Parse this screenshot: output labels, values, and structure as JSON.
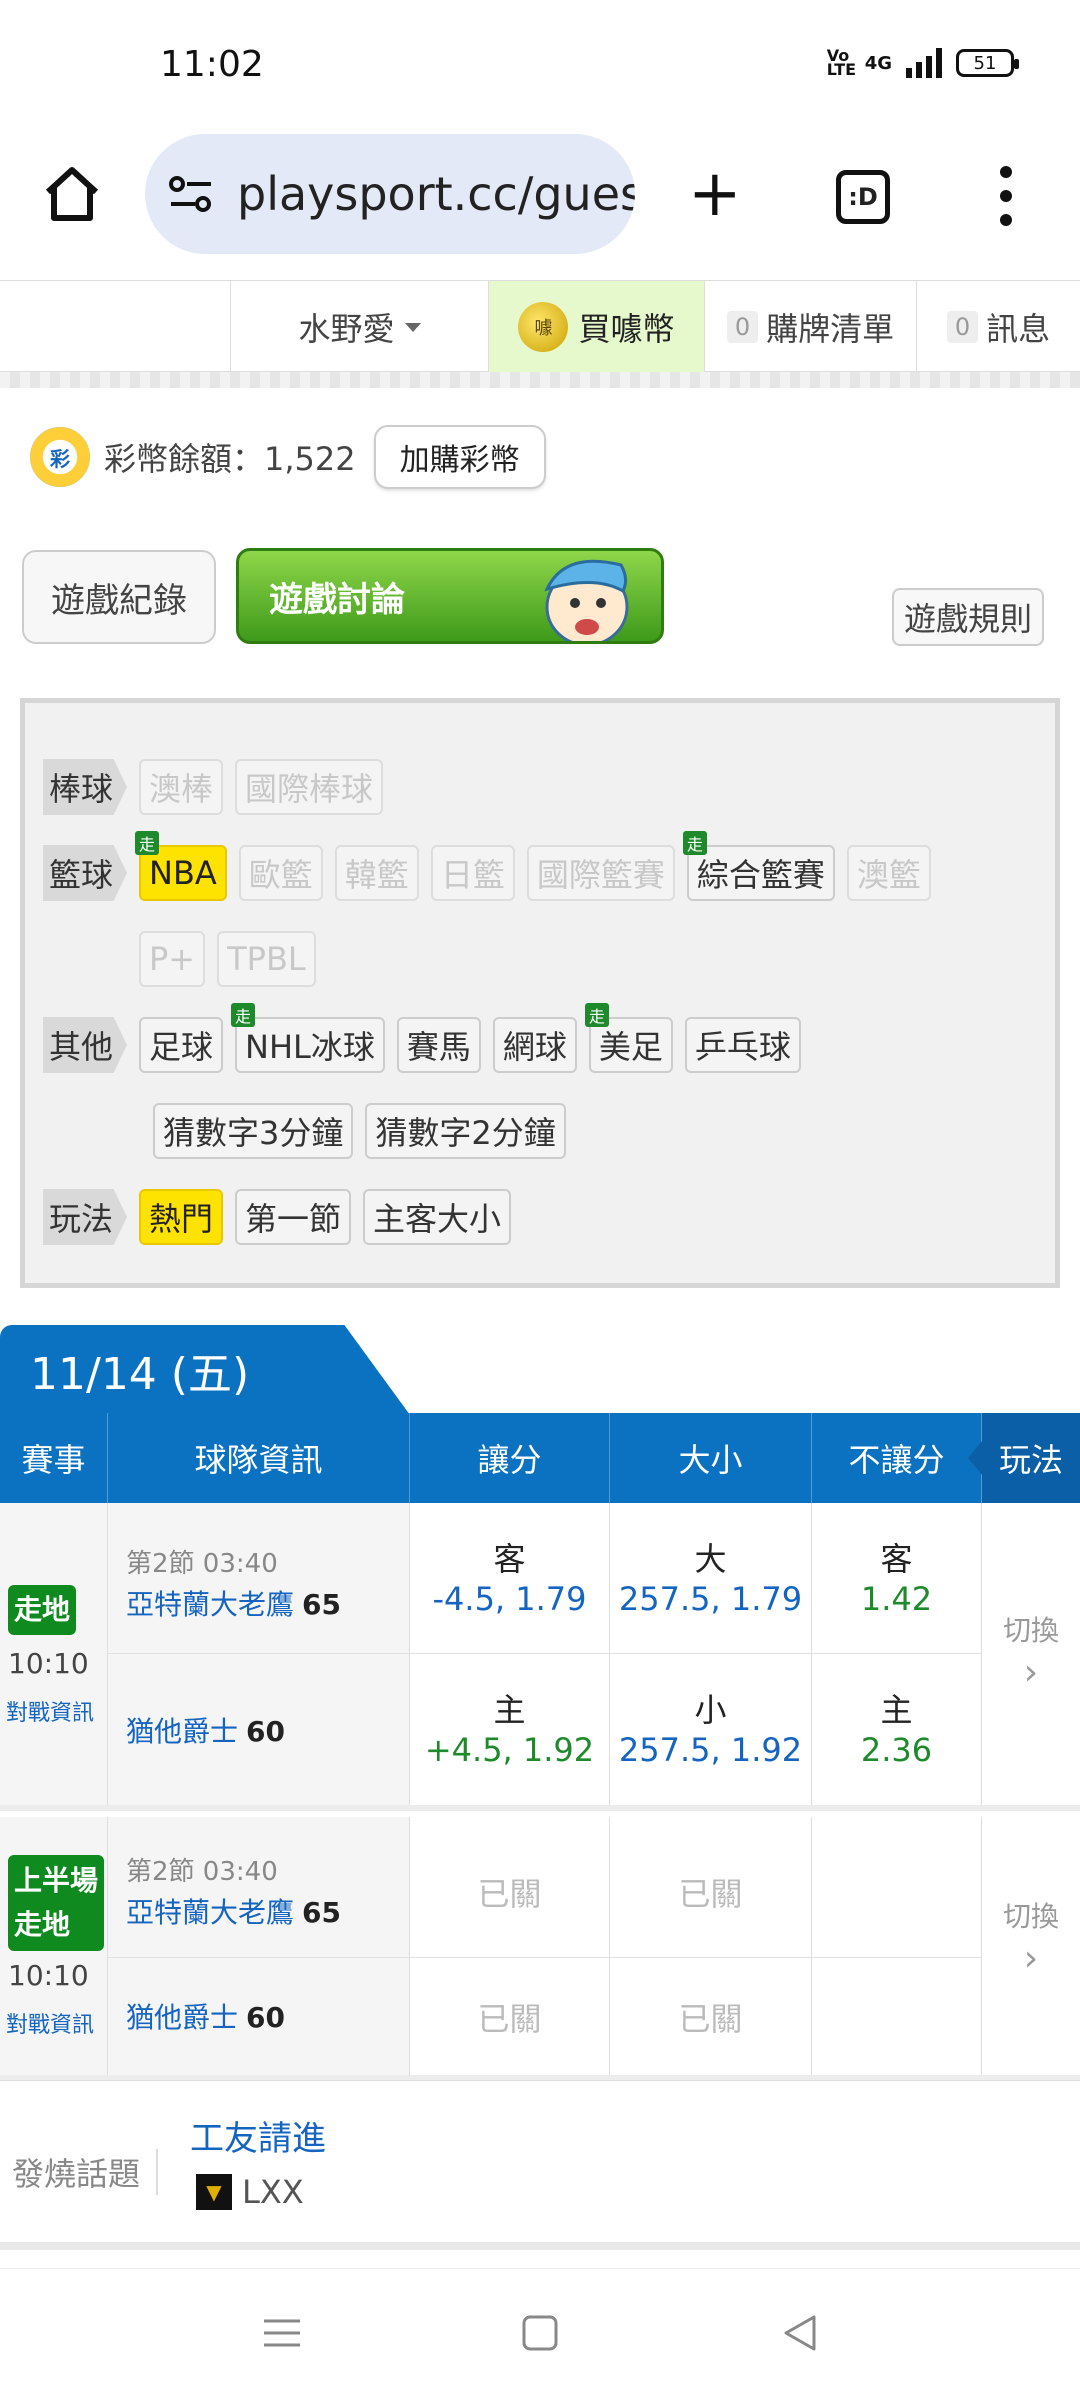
{
  "status_bar": {
    "time": "11:02",
    "volte": "Vo LTE",
    "network": "4G",
    "battery": "51"
  },
  "browser": {
    "url": "playsport.cc/gues",
    "tabs_label": ":D"
  },
  "site_nav": {
    "user": "水野愛",
    "buy_coins": "買噱幣",
    "coin_icon_text": "噱",
    "cart_count": "0",
    "cart_label": "購牌清單",
    "msg_count": "0",
    "msg_label": "訊息"
  },
  "balance": {
    "icon_text": "彩",
    "label": "彩幣餘額：1,522",
    "buy_button": "加購彩幣"
  },
  "game_tabs": {
    "records": "遊戲紀錄",
    "discussion": "遊戲討論",
    "rules": "遊戲規則"
  },
  "filters": {
    "baseball": {
      "label": "棒球",
      "items": [
        "澳棒",
        "國際棒球"
      ]
    },
    "basketball": {
      "label": "籃球",
      "items": [
        "NBA",
        "歐籃",
        "韓籃",
        "日籃",
        "國際籃賽",
        "綜合籃賽",
        "澳籃"
      ],
      "items2": [
        "P+",
        "TPBL"
      ]
    },
    "other": {
      "label": "其他",
      "items": [
        "足球",
        "NHL冰球",
        "賽馬",
        "網球",
        "美足",
        "乒乓球"
      ],
      "items2": [
        "猜數字3分鐘",
        "猜數字2分鐘"
      ]
    },
    "play": {
      "label": "玩法",
      "items": [
        "熱門",
        "第一節",
        "主客大小"
      ]
    },
    "live_badge": "走"
  },
  "date_header": "11/14 (五)",
  "table_header": {
    "event": "賽事",
    "team": "球隊資訊",
    "spread": "讓分",
    "total": "大小",
    "moneyline": "不讓分",
    "play": "玩法"
  },
  "games": [
    {
      "status": "走地",
      "time": "10:10",
      "vs_link": "對戰資訊",
      "period": "第2節 03:40",
      "away": {
        "name": "亞特蘭大老鷹",
        "score": "65"
      },
      "home": {
        "name": "猶他爵士",
        "score": "60"
      },
      "spread": {
        "away_k": "客",
        "away_v": "-4.5, 1.79",
        "home_k": "主",
        "home_v": "+4.5, 1.92"
      },
      "total": {
        "away_k": "大",
        "away_v": "257.5, 1.79",
        "home_k": "小",
        "home_v": "257.5, 1.92"
      },
      "ml": {
        "away_k": "客",
        "away_v": "1.42",
        "home_k": "主",
        "home_v": "2.36"
      },
      "switch": "切換",
      "switch_arrow": "›"
    },
    {
      "status1": "上半場",
      "status2": "走地",
      "time": "10:10",
      "vs_link": "對戰資訊",
      "period": "第2節 03:40",
      "away": {
        "name": "亞特蘭大老鷹",
        "score": "65"
      },
      "home": {
        "name": "猶他爵士",
        "score": "60"
      },
      "closed": "已關",
      "switch": "切換",
      "switch_arrow": "›"
    }
  ],
  "hot_topic": {
    "label": "發燒話題",
    "title": "工友請進",
    "author": "LXX"
  }
}
